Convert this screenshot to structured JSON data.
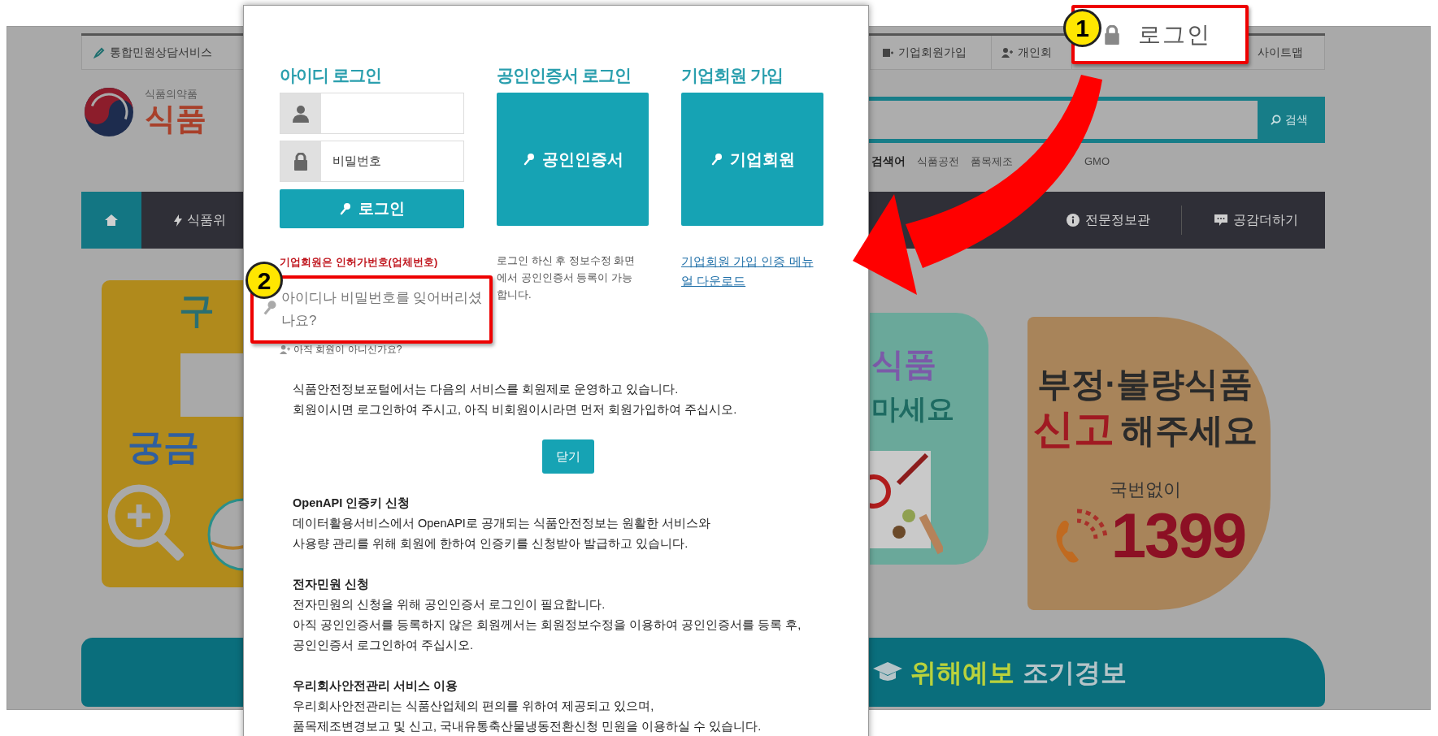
{
  "page": {
    "utility_left": "통합민원상담서비스",
    "utility_right": [
      "기업회원가입",
      "개인회",
      "사이트맵"
    ],
    "logo": {
      "subtitle": "식품의약품",
      "title": "식품"
    },
    "search": {
      "button": "검색"
    },
    "popular": {
      "label": "검색어",
      "keywords": [
        "식품공전",
        "품목제조",
        "GMO"
      ]
    },
    "nav": [
      "식품위",
      "전문정보관",
      "공감더하기"
    ],
    "left_banner": {
      "line_1": "구",
      "line_2": "궁금"
    },
    "middle_banner": {
      "line_1": "식품",
      "line_2": "마세요"
    },
    "right_banner": {
      "line_1": "부정·불량식품",
      "highlight": "신고",
      "line_2": "해주세요",
      "note": "국번없이",
      "phone": "1399"
    },
    "bottom_bar": {
      "highlight": "위해예보",
      "text": "조기경보"
    }
  },
  "modal": {
    "id_login": {
      "title": "아이디 로그인",
      "password_placeholder": "비밀번호",
      "button": "로그인",
      "note": "기업회원은 인허가번호(업체번호)"
    },
    "cert_login": {
      "title": "공인인증서 로그인",
      "button": "공인인증서",
      "note": "로그인 하신 후 정보수정 화면에서 공인인증서 등록이 가능합니다."
    },
    "corp_join": {
      "title": "기업회원 가입",
      "button": "기업회원",
      "link": "기업회원 가입 인증 메뉴얼 다운로드"
    },
    "not_member": "아직 회원이 아니신가요?",
    "intro": [
      "식품안전정보포털에서는 다음의 서비스를 회원제로 운영하고 있습니다.",
      "회원이시면 로그인하여 주시고, 아직 비회원이시라면 먼저 회원가입하여 주십시오."
    ],
    "close_button": "닫기",
    "sections": [
      {
        "title": "OpenAPI 인증키 신청",
        "lines": [
          "데이터활용서비스에서 OpenAPI로 공개되는 식품안전정보는 원활한 서비스와",
          "사용량 관리를 위해 회원에 한하여 인증키를 신청받아 발급하고 있습니다."
        ]
      },
      {
        "title": "전자민원 신청",
        "lines": [
          "전자민원의 신청을 위해 공인인증서 로그인이 필요합니다.",
          "아직 공인인증서를 등록하지 않은 회원께서는 회원정보수정을 이용하여 공인인증서를 등록 후,",
          "공인인증서 로그인하여 주십시오."
        ]
      },
      {
        "title": "우리회사안전관리 서비스 이용",
        "lines": [
          "우리회사안전관리는 식품산업체의 편의를 위하여 제공되고 있으며,",
          "품목제조변경보고 및 신고, 국내유통축산물냉동전환신청 민원을 이용하실 수 있습니다."
        ]
      }
    ]
  },
  "callouts": [
    {
      "number": "1",
      "label": "로그인"
    },
    {
      "number": "2",
      "label": "아이디나 비밀번호를 잊어버리셨나요?"
    }
  ]
}
